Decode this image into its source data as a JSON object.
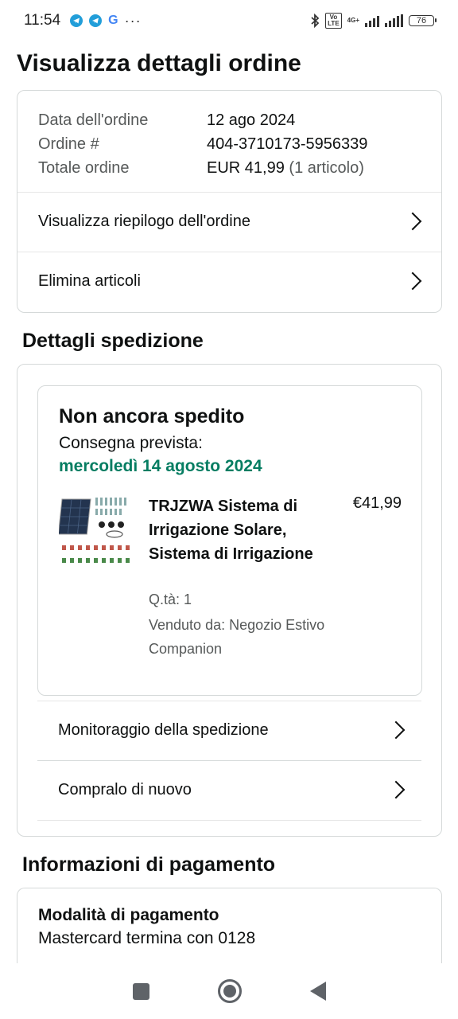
{
  "status_bar": {
    "time": "11:54",
    "icons": [
      "telegram-icon",
      "telegram-icon",
      "google-icon",
      "more-icon",
      "bluetooth-icon",
      "volte-icon",
      "signal-icon",
      "signal-icon"
    ],
    "network": "4G+",
    "battery": "76"
  },
  "page": {
    "title": "Visualizza dettagli ordine"
  },
  "order_summary": {
    "date_label": "Data dell'ordine",
    "date_value": "12 ago 2024",
    "order_label": "Ordine #",
    "order_value": "404-3710173-5956339",
    "total_label": "Totale ordine",
    "total_value": "EUR 41,99",
    "total_count": "(1 articolo)",
    "links": [
      {
        "label": "Visualizza riepilogo dell'ordine",
        "icon": "chevron-right-icon"
      },
      {
        "label": "Elimina articoli",
        "icon": "chevron-right-icon"
      }
    ]
  },
  "shipping": {
    "section_title": "Dettagli spedizione",
    "status": "Non ancora spedito",
    "delivery_label": "Consegna prevista:",
    "delivery_date": "mercoledì 14 agosto 2024",
    "delivery_color": "#067d62",
    "item": {
      "title": "TRJZWA Sistema di Irrigazione Solare, Sistema di Irrigazione",
      "price": "€41,99",
      "qty": "Q.tà: 1",
      "seller": "Venduto da: Negozio Estivo Companion"
    },
    "links": [
      {
        "label": "Monitoraggio della spedizione",
        "icon": "chevron-right-icon"
      },
      {
        "label": "Compralo di nuovo",
        "icon": "chevron-right-icon"
      }
    ]
  },
  "payment": {
    "section_title": "Informazioni di pagamento",
    "method_label": "Modalità di pagamento",
    "method_value": "Mastercard  termina con 0128"
  },
  "nav": {
    "buttons": [
      "recents-button",
      "home-button",
      "back-button"
    ]
  }
}
